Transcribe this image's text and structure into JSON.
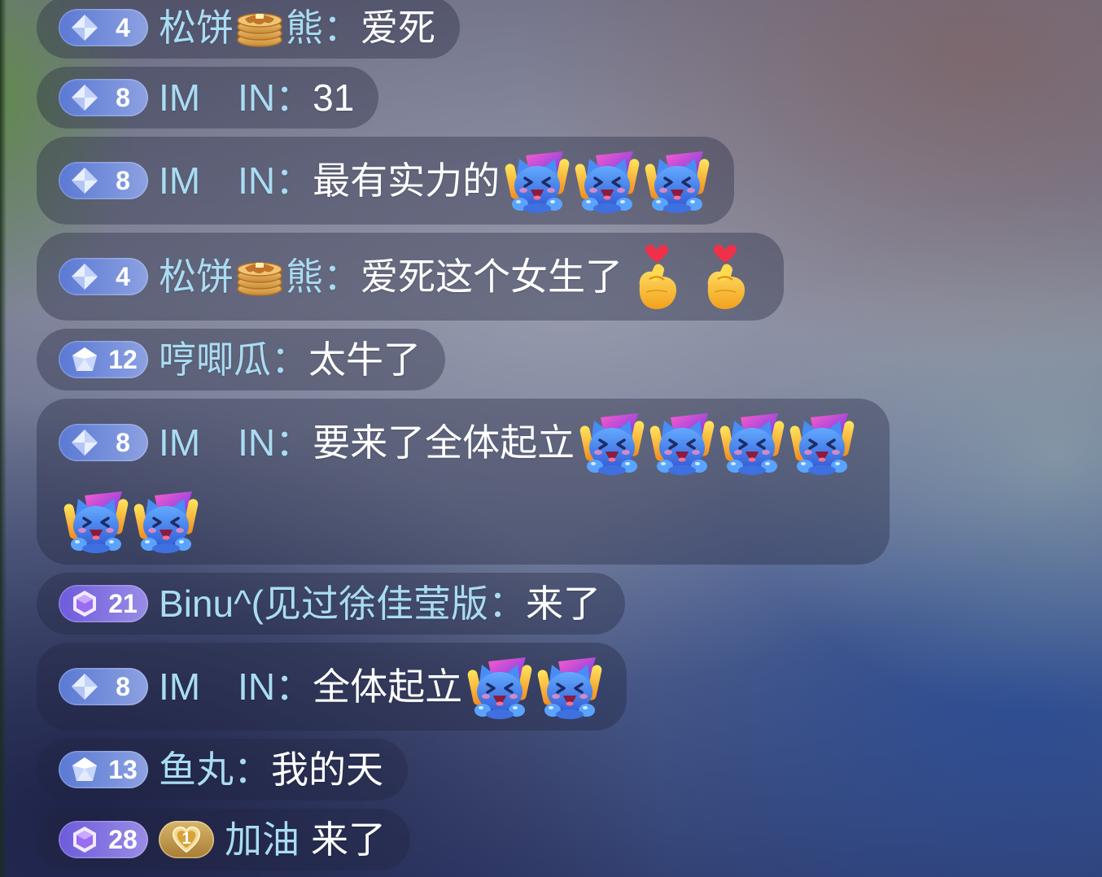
{
  "colors": {
    "username": "#a9dcf3",
    "message": "#ffffff",
    "badge_blue": "#5b79d4",
    "badge_purple": "#6d5bdb",
    "fan_badge_gold": "#c99a45"
  },
  "chat": {
    "messages": [
      {
        "badge": {
          "level": "4",
          "gem": "diamond-gem-icon",
          "color": "#5b79d4"
        },
        "name": [
          {
            "text": "松饼"
          },
          {
            "icon": "pancake-icon"
          },
          {
            "text": "熊"
          }
        ],
        "separator": "：",
        "content": [
          {
            "text": "爱死"
          }
        ]
      },
      {
        "badge": {
          "level": "8",
          "gem": "diamond-gem-icon",
          "color": "#5b79d4"
        },
        "name": [
          {
            "text": "IM　IN"
          }
        ],
        "separator": "：",
        "content": [
          {
            "text": "31"
          }
        ]
      },
      {
        "badge": {
          "level": "8",
          "gem": "diamond-gem-icon",
          "color": "#5b79d4"
        },
        "name": [
          {
            "text": "IM　IN"
          }
        ],
        "separator": "：",
        "content": [
          {
            "text": "最有实力的"
          },
          {
            "icon": "cheering-cat-icon"
          },
          {
            "icon": "cheering-cat-icon"
          },
          {
            "icon": "cheering-cat-icon"
          }
        ]
      },
      {
        "badge": {
          "level": "4",
          "gem": "diamond-gem-icon",
          "color": "#5b79d4"
        },
        "name": [
          {
            "text": "松饼"
          },
          {
            "icon": "pancake-icon"
          },
          {
            "text": "熊"
          }
        ],
        "separator": "：",
        "content": [
          {
            "text": "爱死这个女生了"
          },
          {
            "icon": "finger-heart-icon"
          },
          {
            "icon": "finger-heart-icon"
          }
        ]
      },
      {
        "badge": {
          "level": "12",
          "gem": "pentagon-gem-icon",
          "color": "#5b79d4"
        },
        "name": [
          {
            "text": "哼唧瓜"
          }
        ],
        "separator": "：",
        "content": [
          {
            "text": "太牛了"
          }
        ]
      },
      {
        "badge": {
          "level": "8",
          "gem": "diamond-gem-icon",
          "color": "#5b79d4"
        },
        "name": [
          {
            "text": "IM　IN"
          }
        ],
        "separator": "：",
        "content": [
          {
            "text": "要来了全体起立"
          },
          {
            "icon": "cheering-cat-icon"
          },
          {
            "icon": "cheering-cat-icon"
          },
          {
            "icon": "cheering-cat-icon"
          },
          {
            "icon": "cheering-cat-icon"
          },
          {
            "icon": "cheering-cat-icon"
          },
          {
            "icon": "cheering-cat-icon"
          }
        ]
      },
      {
        "badge": {
          "level": "21",
          "gem": "hexagon-gem-icon",
          "color": "#6d5bdb"
        },
        "name": [
          {
            "text": "Binu^(见过徐佳莹版"
          }
        ],
        "separator": "：",
        "content": [
          {
            "text": "来了"
          }
        ]
      },
      {
        "badge": {
          "level": "8",
          "gem": "diamond-gem-icon",
          "color": "#5b79d4"
        },
        "name": [
          {
            "text": "IM　IN"
          }
        ],
        "separator": "：",
        "content": [
          {
            "text": "全体起立"
          },
          {
            "icon": "cheering-cat-icon"
          },
          {
            "icon": "cheering-cat-icon"
          }
        ]
      },
      {
        "badge": {
          "level": "13",
          "gem": "pentagon-gem-icon",
          "color": "#5b79d4"
        },
        "name": [
          {
            "text": "鱼丸"
          }
        ],
        "separator": "：",
        "content": [
          {
            "text": "我的天"
          }
        ]
      },
      {
        "badge": {
          "level": "28",
          "gem": "hexagon-gem-icon",
          "color": "#6d5bdb"
        },
        "fan_badge": {
          "level": "1",
          "icon": "fan-club-heart-icon"
        },
        "name": [
          {
            "text": "加油"
          }
        ],
        "content": [
          {
            "text": "来了"
          }
        ]
      }
    ]
  }
}
